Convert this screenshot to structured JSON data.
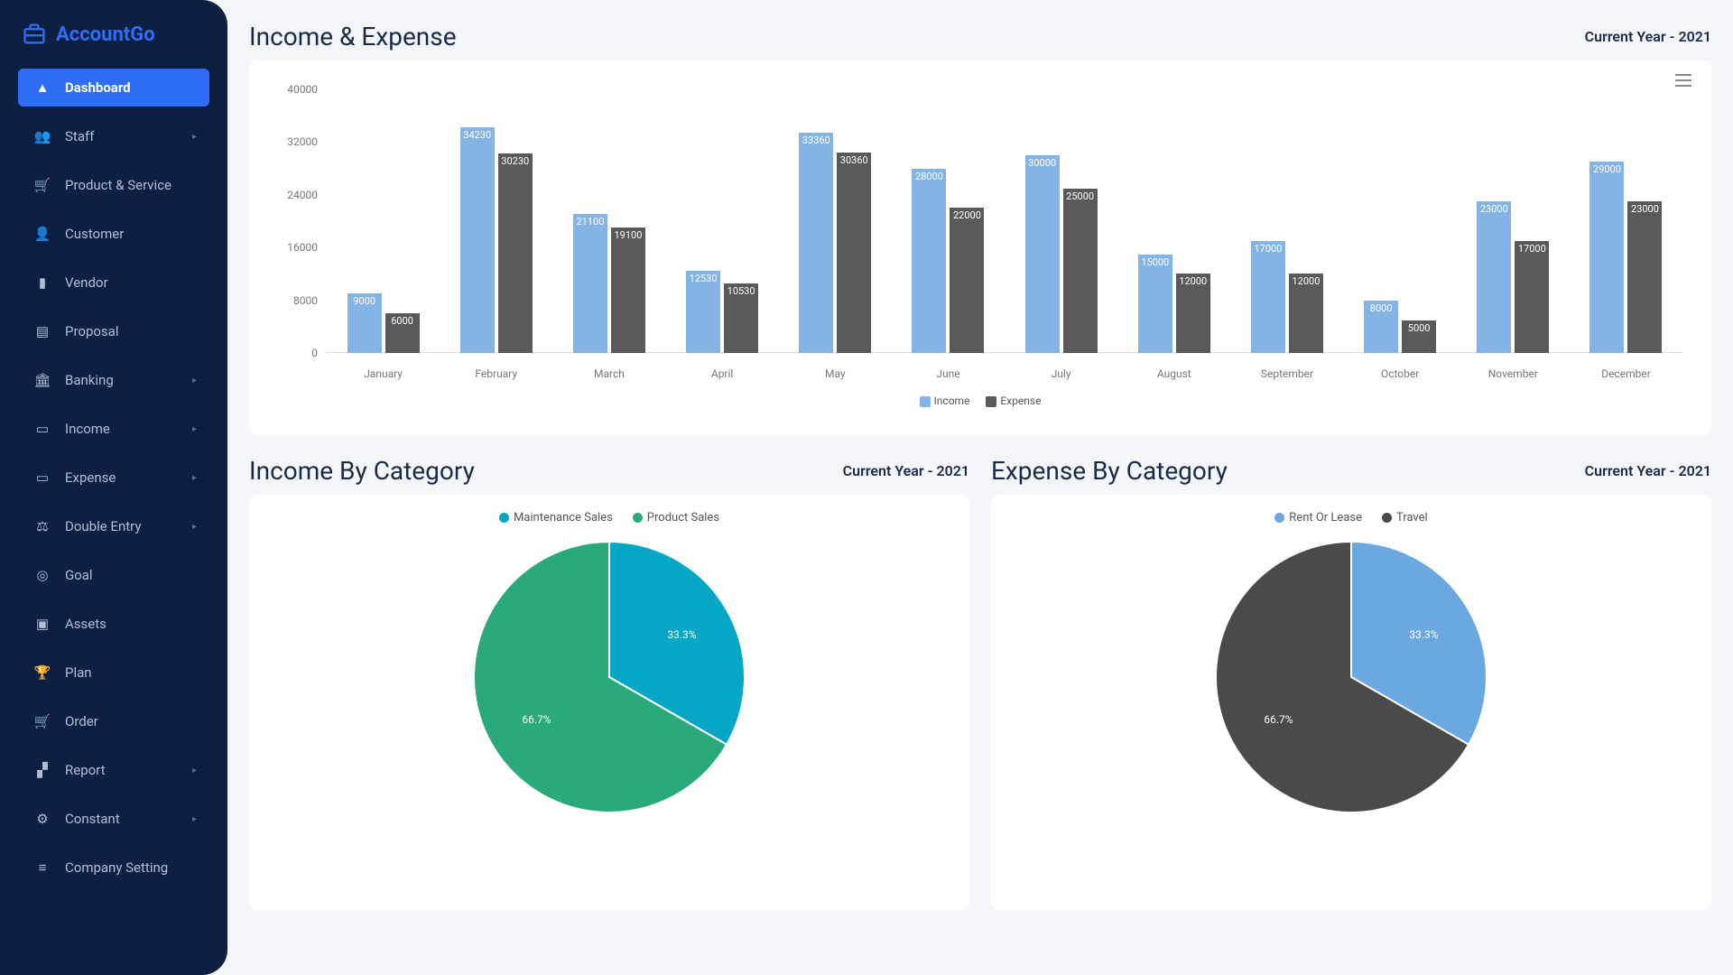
{
  "brand": {
    "name": "AccountGo"
  },
  "sidebar": {
    "items": [
      {
        "label": "Dashboard",
        "icon": "fire",
        "active": true
      },
      {
        "label": "Staff",
        "icon": "users",
        "expandable": true
      },
      {
        "label": "Product & Service",
        "icon": "cart"
      },
      {
        "label": "Customer",
        "icon": "person"
      },
      {
        "label": "Vendor",
        "icon": "file"
      },
      {
        "label": "Proposal",
        "icon": "sheet"
      },
      {
        "label": "Banking",
        "icon": "bank",
        "expandable": true
      },
      {
        "label": "Income",
        "icon": "cash",
        "expandable": true
      },
      {
        "label": "Expense",
        "icon": "cash",
        "expandable": true
      },
      {
        "label": "Double Entry",
        "icon": "scale",
        "expandable": true
      },
      {
        "label": "Goal",
        "icon": "target"
      },
      {
        "label": "Assets",
        "icon": "box"
      },
      {
        "label": "Plan",
        "icon": "trophy"
      },
      {
        "label": "Order",
        "icon": "cart"
      },
      {
        "label": "Report",
        "icon": "chart",
        "expandable": true
      },
      {
        "label": "Constant",
        "icon": "gear",
        "expandable": true
      },
      {
        "label": "Company Setting",
        "icon": "lines"
      }
    ]
  },
  "sections": {
    "income_expense": {
      "title": "Income & Expense",
      "note": "Current Year - 2021"
    },
    "income_cat": {
      "title": "Income By Category",
      "note": "Current Year - 2021"
    },
    "expense_cat": {
      "title": "Expense By Category",
      "note": "Current Year - 2021"
    }
  },
  "chart_data": [
    {
      "id": "income_expense_bar",
      "type": "bar",
      "title": "Income & Expense",
      "ylim": [
        0,
        40000
      ],
      "yticks": [
        0,
        8000,
        16000,
        24000,
        32000,
        40000
      ],
      "categories": [
        "January",
        "February",
        "March",
        "April",
        "May",
        "June",
        "July",
        "August",
        "September",
        "October",
        "November",
        "December"
      ],
      "series": [
        {
          "name": "Income",
          "color": "#84b3e6",
          "values": [
            9000,
            34230,
            21100,
            12530,
            33360,
            28000,
            30000,
            15000,
            17000,
            8000,
            23000,
            29000
          ]
        },
        {
          "name": "Expense",
          "color": "#595959",
          "values": [
            6000,
            30230,
            19100,
            10530,
            30360,
            22000,
            25000,
            12000,
            12000,
            5000,
            17000,
            23000
          ]
        }
      ]
    },
    {
      "id": "income_by_category_pie",
      "type": "pie",
      "title": "Income By Category",
      "series": [
        {
          "name": "Maintenance Sales",
          "color": "#05a6c6",
          "value": 33.3
        },
        {
          "name": "Product Sales",
          "color": "#2aa97b",
          "value": 66.7
        }
      ]
    },
    {
      "id": "expense_by_category_pie",
      "type": "pie",
      "title": "Expense By Category",
      "series": [
        {
          "name": "Rent Or Lease",
          "color": "#6ca8e0",
          "value": 33.3
        },
        {
          "name": "Travel",
          "color": "#4a4a4a",
          "value": 66.7
        }
      ]
    }
  ],
  "icon_glyphs": {
    "fire": "▲",
    "users": "👥",
    "cart": "🛒",
    "person": "👤",
    "file": "▮",
    "sheet": "▤",
    "bank": "🏛",
    "cash": "▭",
    "scale": "⚖",
    "target": "◎",
    "box": "▣",
    "trophy": "🏆",
    "chart": "▞",
    "gear": "⚙",
    "lines": "≡"
  }
}
